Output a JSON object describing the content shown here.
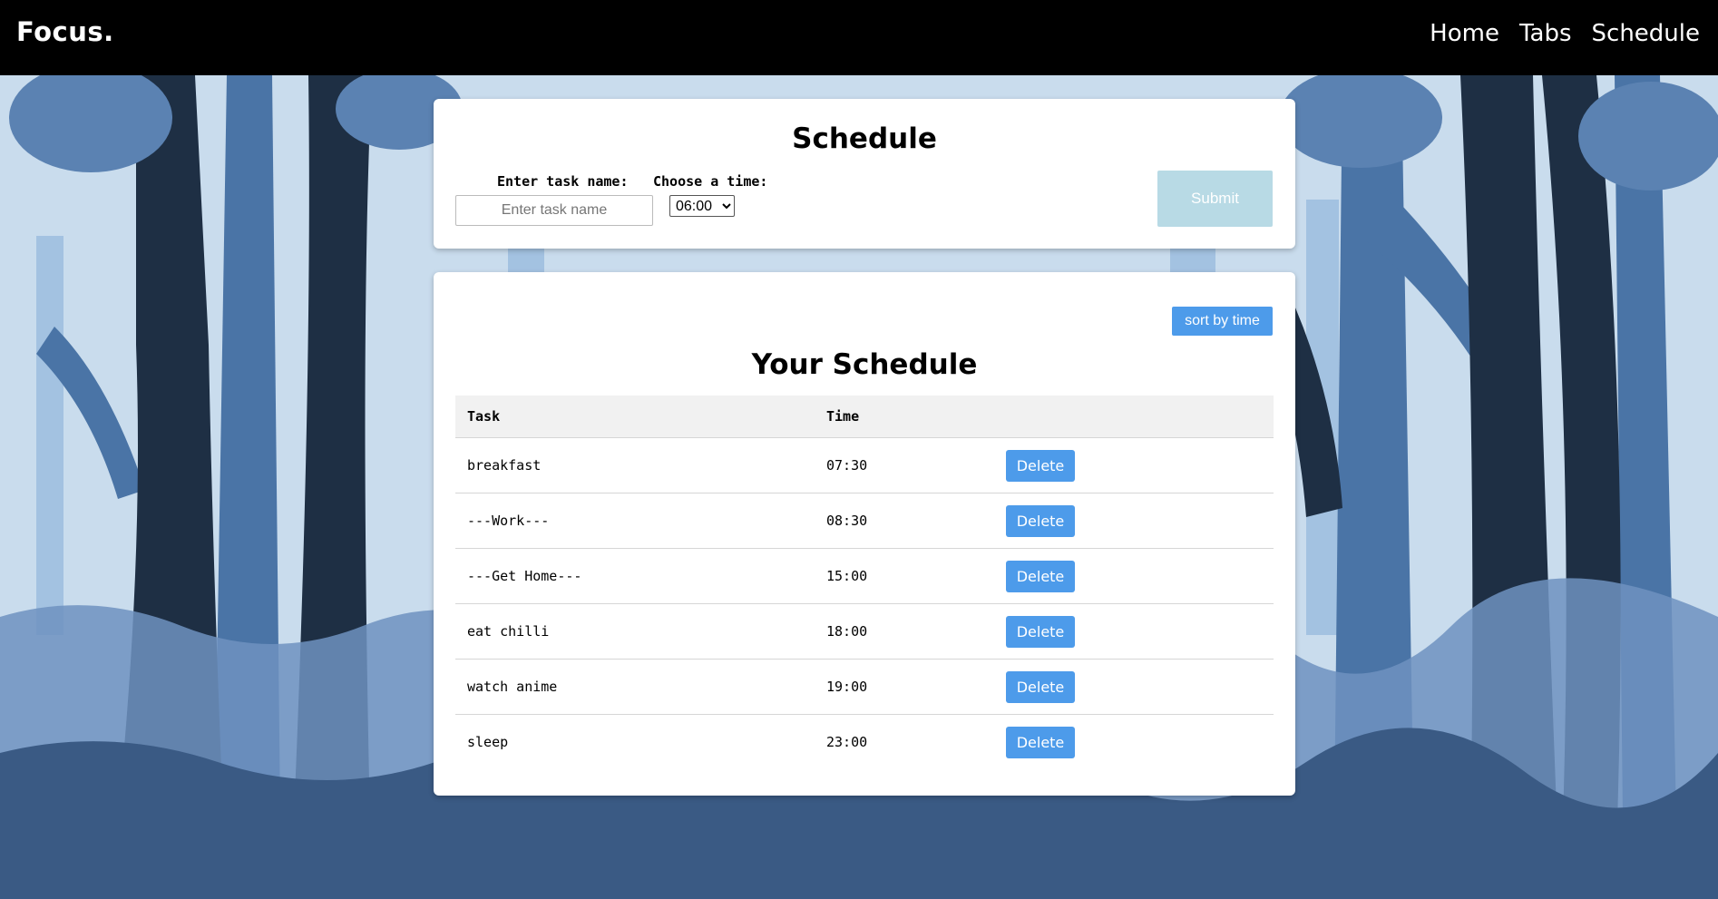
{
  "navbar": {
    "brand": "Focus.",
    "links": [
      "Home",
      "Tabs",
      "Schedule"
    ]
  },
  "form": {
    "title": "Schedule",
    "task_label": "Enter task name:",
    "task_placeholder": "Enter task name",
    "task_value": "",
    "time_label": "Choose a time:",
    "time_selected": "06:00",
    "submit_label": "Submit"
  },
  "schedule": {
    "sort_label": "sort by time",
    "title": "Your Schedule",
    "columns": [
      "Task",
      "Time",
      ""
    ],
    "delete_label": "Delete",
    "rows": [
      {
        "task": "breakfast",
        "time": "07:30"
      },
      {
        "task": "---Work---",
        "time": "08:30"
      },
      {
        "task": "---Get Home---",
        "time": "15:00"
      },
      {
        "task": "eat chilli",
        "time": "18:00"
      },
      {
        "task": "watch anime",
        "time": "19:00"
      },
      {
        "task": "sleep",
        "time": "23:00"
      }
    ]
  },
  "colors": {
    "navbar_bg": "#000000",
    "accent_button": "#4d9bea",
    "submit_disabled": "#b8dae5",
    "sky": "#c9dced",
    "tree_dark": "#1e2f44",
    "tree_mid": "#3f6591",
    "grass": "#5b7fae"
  }
}
